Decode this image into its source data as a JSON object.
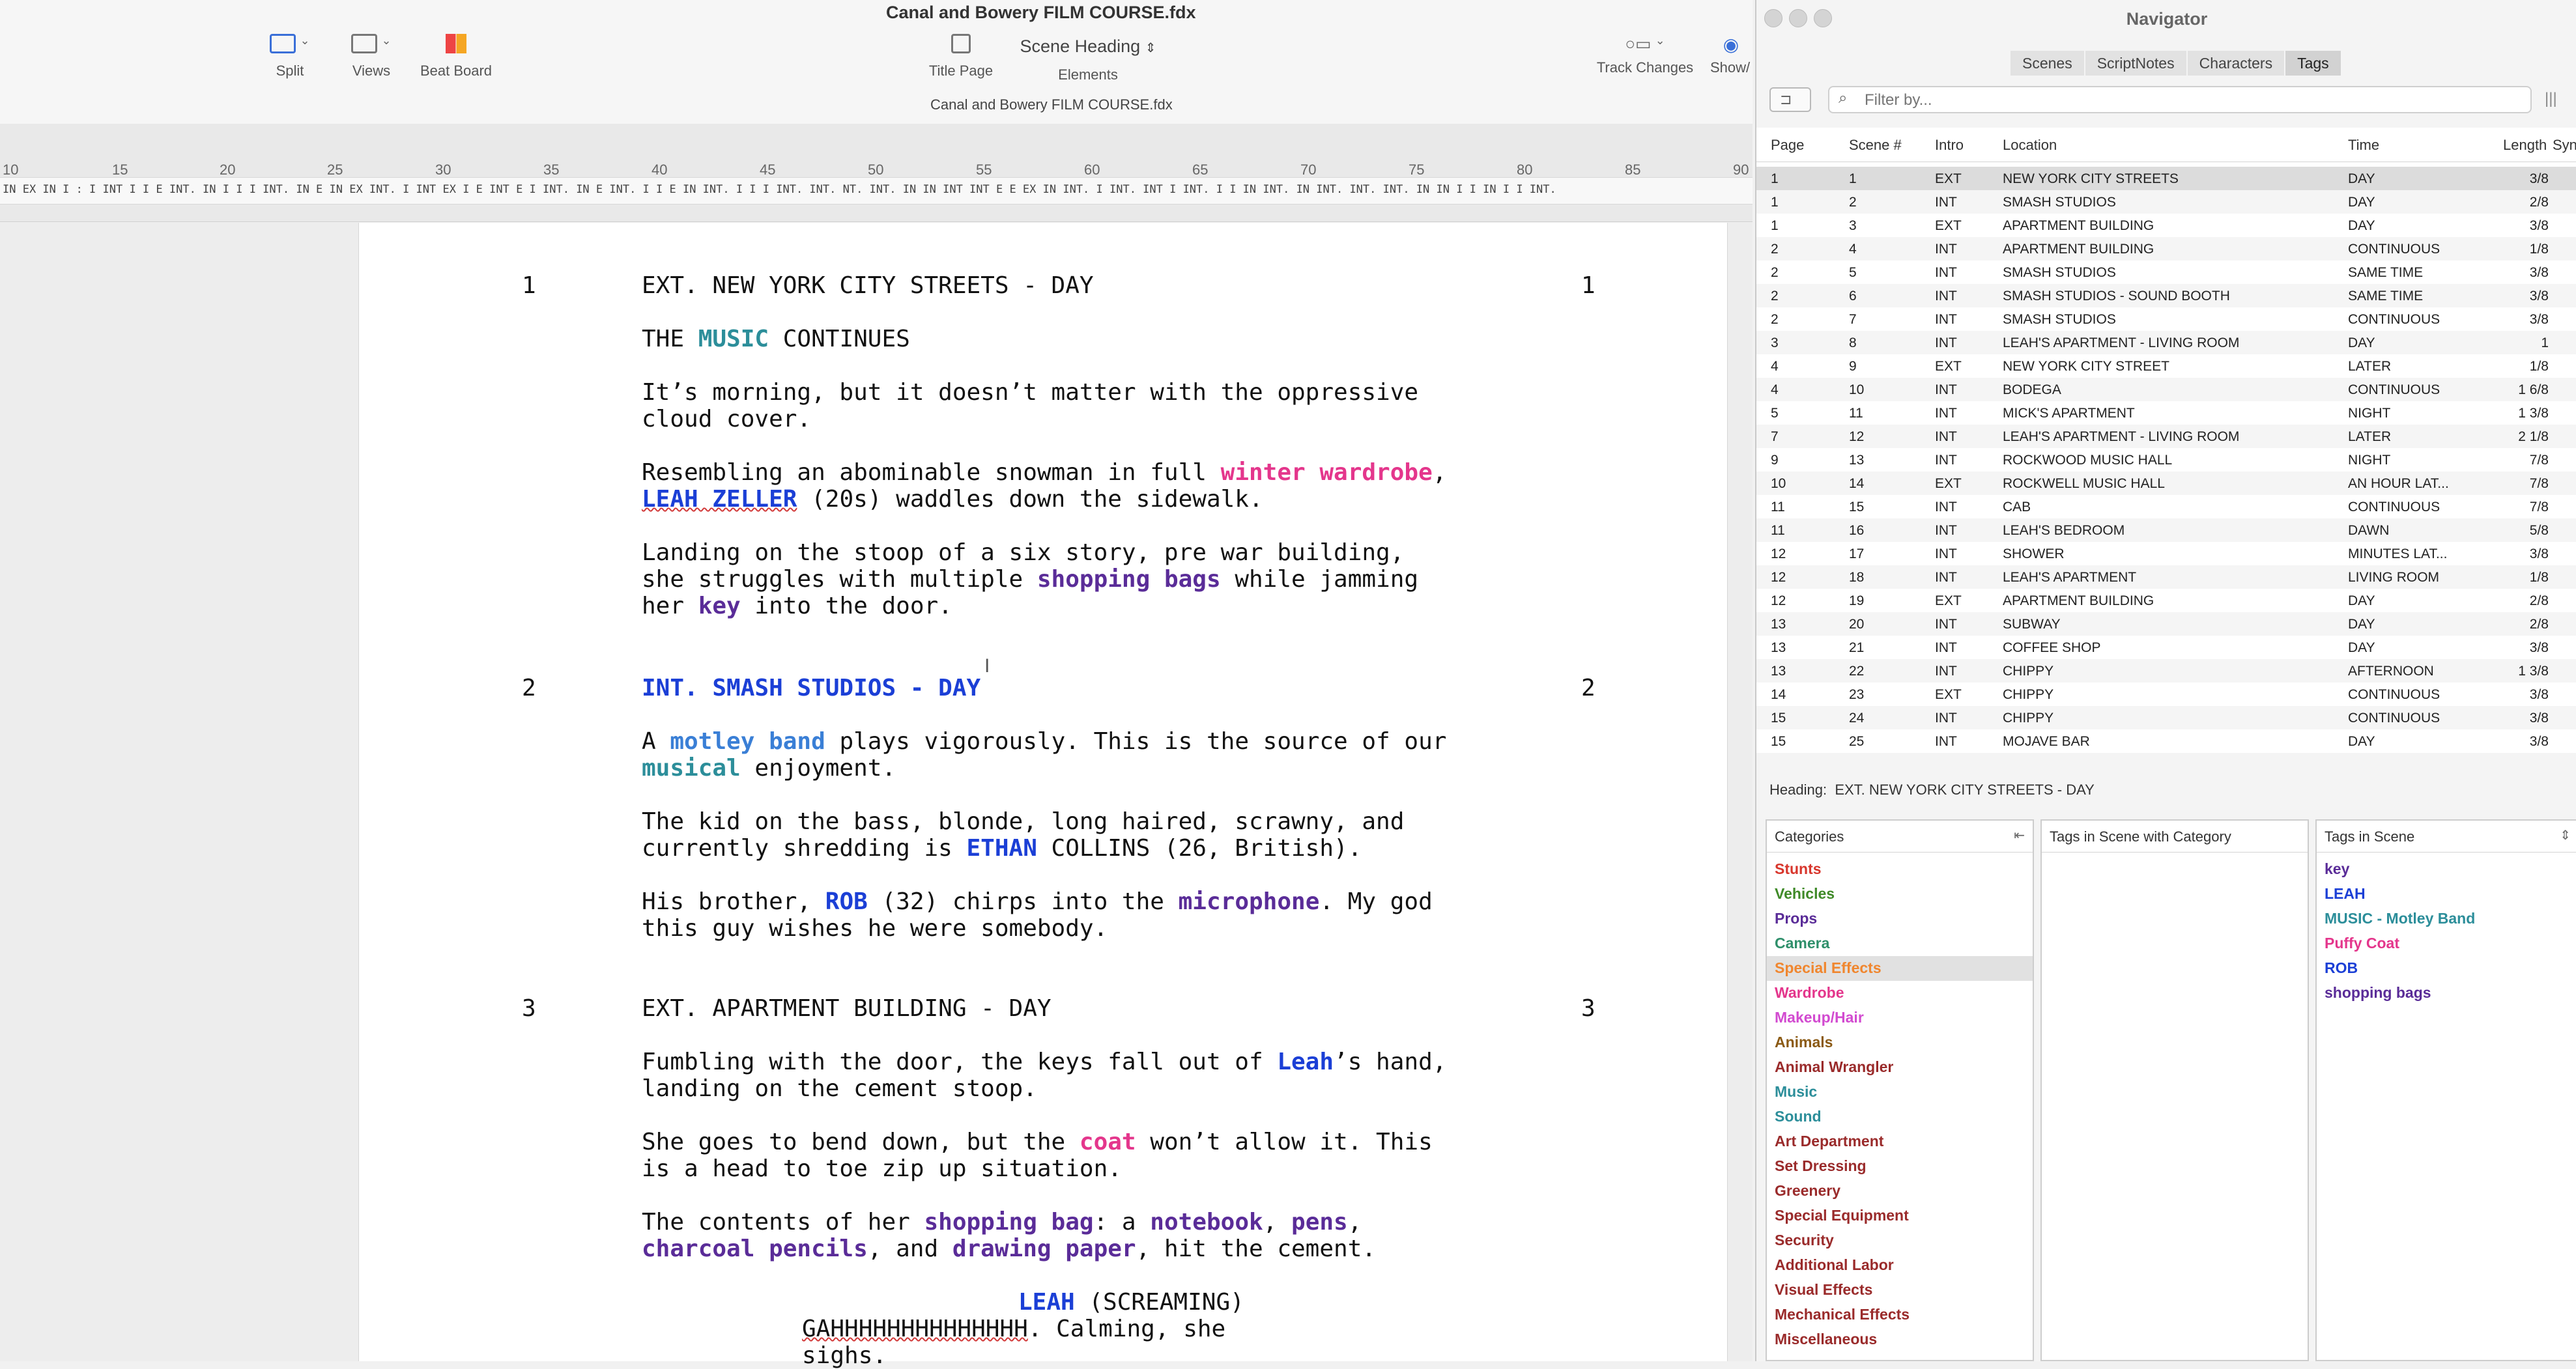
{
  "toolbar": {
    "document_title": "Canal and Bowery FILM COURSE.fdx",
    "document_subtitle": "Canal and Bowery FILM COURSE.fdx",
    "split_label": "Split",
    "views_label": "Views",
    "beat_board_label": "Beat Board",
    "title_page_label": "Title Page",
    "elements_value": "Scene Heading",
    "elements_label": "Elements",
    "track_changes_label": "Track Changes",
    "show_label": "Show/"
  },
  "ruler": {
    "numbers": [
      "10",
      "15",
      "20",
      "25",
      "30",
      "35",
      "40",
      "45",
      "50",
      "55",
      "60",
      "65",
      "70",
      "75",
      "80",
      "85",
      "90"
    ],
    "strip_text": "IN EX IN I : I INT I I E INT. IN I I I INT. IN E IN EX INT. I INT EX I E INT E I  INT.  IN E INT. I I E IN INT. I I I INT. INT. NT. INT. IN IN INT INT E E EX IN INT. I INT. INT I INT. I I IN INT. IN INT.  INT.  INT.  IN IN I I IN I I INT."
  },
  "script": {
    "scenes": [
      {
        "number": "1",
        "heading": "EXT. NEW YORK CITY STREETS - DAY"
      },
      {
        "number": "2",
        "heading": "INT. SMASH STUDIOS - DAY"
      },
      {
        "number": "3",
        "heading": "EXT. APARTMENT BUILDING - DAY"
      }
    ],
    "s1_a1": "THE ",
    "s1_a1_tag": "MUSIC",
    "s1_a1_rest": " CONTINUES",
    "s1_a2_l1": "It’s morning, but it doesn’t matter with the oppressive",
    "s1_a2_l2": "cloud cover.",
    "s1_a3_l1_pre": "Resembling an abominable snowman in full ",
    "s1_a3_l1_tag": "winter wardrobe",
    "s1_a3_l1_post": ",",
    "s1_a3_l2_tag": "LEAH ZELLER",
    "s1_a3_l2_post": " (20s) waddles down the sidewalk.",
    "s1_a4_l1": "Landing on the stoop of a six story, pre war building,",
    "s1_a4_l2_pre": "she struggles with multiple ",
    "s1_a4_l2_tag": "shopping bags",
    "s1_a4_l2_post": " while jamming",
    "s1_a4_l3_pre": "her ",
    "s1_a4_l3_tag": "key",
    "s1_a4_l3_post": " into the door.",
    "s2_a1_l1_pre": "A ",
    "s2_a1_l1_tag": "motley band",
    "s2_a1_l1_post": " plays vigorously. This is the source of our",
    "s2_a1_l2_tag": "musical",
    "s2_a1_l2_post": " enjoyment.",
    "s2_a2_l1": "The kid on the bass, blonde, long haired, scrawny, and",
    "s2_a2_l2_pre": "currently shredding is ",
    "s2_a2_l2_tag": "ETHAN",
    "s2_a2_l2_post": " COLLINS (26, British).",
    "s2_a3_l1_pre": "His brother, ",
    "s2_a3_l1_tag1": "ROB",
    "s2_a3_l1_mid": " (32) chirps into the ",
    "s2_a3_l1_tag2": "microphone",
    "s2_a3_l1_post": ". My god",
    "s2_a3_l2": "this guy wishes he were somebody.",
    "s3_a1_l1_pre": "Fumbling with the door, the keys fall out of ",
    "s3_a1_l1_tag": "Leah",
    "s3_a1_l1_post": "’s hand,",
    "s3_a1_l2": "landing on the cement stoop.",
    "s3_a2_l1_pre": "She goes to bend down, but the ",
    "s3_a2_l1_tag": "coat",
    "s3_a2_l1_post": " won’t allow it. This",
    "s3_a2_l2": "is a head to toe zip up situation.",
    "s3_a3_l1_pre": "The contents of her ",
    "s3_a3_l1_tag1": "shopping bag",
    "s3_a3_l1_mid1": ": a ",
    "s3_a3_l1_tag2": "notebook",
    "s3_a3_l1_mid2": ", ",
    "s3_a3_l1_tag3": "pens",
    "s3_a3_l1_post": ",",
    "s3_a3_l2_tag1": "charcoal pencils",
    "s3_a3_l2_mid": ", and ",
    "s3_a3_l2_tag2": "drawing paper",
    "s3_a3_l2_post": ", hit the cement.",
    "char_name": "LEAH",
    "char_ext": " (SCREAMING)",
    "dlg_l1_wavy": "GAHHHHHHHHHHHHHH",
    "dlg_l1_post": ". Calming, she",
    "dlg_l2": "sighs."
  },
  "navigator": {
    "title": "Navigator",
    "tabs": [
      "Scenes",
      "ScriptNotes",
      "Characters",
      "Tags"
    ],
    "active_tab": "Tags",
    "filter_placeholder": "Filter by...",
    "columns": [
      "Page",
      "Scene #",
      "Intro",
      "Location",
      "Time",
      "Length",
      "Syn"
    ],
    "rows": [
      [
        "1",
        "1",
        "EXT",
        "NEW YORK CITY STREETS",
        "DAY",
        "3/8"
      ],
      [
        "1",
        "2",
        "INT",
        "SMASH STUDIOS",
        "DAY",
        "2/8"
      ],
      [
        "1",
        "3",
        "EXT",
        "APARTMENT BUILDING",
        "DAY",
        "3/8"
      ],
      [
        "2",
        "4",
        "INT",
        "APARTMENT BUILDING",
        "CONTINUOUS",
        "1/8"
      ],
      [
        "2",
        "5",
        "INT",
        "SMASH STUDIOS",
        "SAME TIME",
        "3/8"
      ],
      [
        "2",
        "6",
        "INT",
        "SMASH STUDIOS - SOUND BOOTH",
        "SAME TIME",
        "3/8"
      ],
      [
        "2",
        "7",
        "INT",
        "SMASH STUDIOS",
        "CONTINUOUS",
        "3/8"
      ],
      [
        "3",
        "8",
        "INT",
        "LEAH'S APARTMENT - LIVING ROOM",
        "DAY",
        "1"
      ],
      [
        "4",
        "9",
        "EXT",
        "NEW YORK CITY STREET",
        "LATER",
        "1/8"
      ],
      [
        "4",
        "10",
        "INT",
        "BODEGA",
        "CONTINUOUS",
        "1 6/8"
      ],
      [
        "5",
        "11",
        "INT",
        "MICK'S APARTMENT",
        "NIGHT",
        "1 3/8"
      ],
      [
        "7",
        "12",
        "INT",
        "LEAH'S APARTMENT - LIVING ROOM",
        "LATER",
        "2 1/8"
      ],
      [
        "9",
        "13",
        "INT",
        "ROCKWOOD MUSIC HALL",
        "NIGHT",
        "7/8"
      ],
      [
        "10",
        "14",
        "EXT",
        "ROCKWELL MUSIC HALL",
        "AN HOUR LAT...",
        "7/8"
      ],
      [
        "11",
        "15",
        "INT",
        "CAB",
        "CONTINUOUS",
        "7/8"
      ],
      [
        "11",
        "16",
        "INT",
        "LEAH'S BEDROOM",
        "DAWN",
        "5/8"
      ],
      [
        "12",
        "17",
        "INT",
        "SHOWER",
        "MINUTES LAT...",
        "3/8"
      ],
      [
        "12",
        "18",
        "INT",
        "LEAH'S APARTMENT",
        "LIVING ROOM",
        "1/8"
      ],
      [
        "12",
        "19",
        "EXT",
        "APARTMENT BUILDING",
        "DAY",
        "2/8"
      ],
      [
        "13",
        "20",
        "INT",
        "SUBWAY",
        "DAY",
        "2/8"
      ],
      [
        "13",
        "21",
        "INT",
        "COFFEE SHOP",
        "DAY",
        "3/8"
      ],
      [
        "13",
        "22",
        "INT",
        "CHIPPY",
        "AFTERNOON",
        "1 3/8"
      ],
      [
        "14",
        "23",
        "EXT",
        "CHIPPY",
        "CONTINUOUS",
        "3/8"
      ],
      [
        "15",
        "24",
        "INT",
        "CHIPPY",
        "CONTINUOUS",
        "3/8"
      ],
      [
        "15",
        "25",
        "INT",
        "MOJAVE BAR",
        "DAY",
        "3/8"
      ]
    ],
    "heading_label": "Heading:",
    "heading_value": "EXT. NEW YORK CITY STREETS - DAY",
    "categories_header": "Categories",
    "tags_with_category_header": "Tags in Scene with Category",
    "tags_in_scene_header": "Tags in Scene",
    "categories": [
      {
        "name": "Stunts",
        "color": "#d8362c"
      },
      {
        "name": "Vehicles",
        "color": "#3f8a28"
      },
      {
        "name": "Props",
        "color": "#5a2c98"
      },
      {
        "name": "Camera",
        "color": "#2e8f6a"
      },
      {
        "name": "Special Effects",
        "color": "#f0862e"
      },
      {
        "name": "Wardrobe",
        "color": "#e4368c"
      },
      {
        "name": "Makeup/Hair",
        "color": "#d24ad0"
      },
      {
        "name": "Animals",
        "color": "#8b5a14"
      },
      {
        "name": "Animal Wrangler",
        "color": "#9a2b2b"
      },
      {
        "name": "Music",
        "color": "#2c8e9a"
      },
      {
        "name": "Sound",
        "color": "#2c8e9a"
      },
      {
        "name": "Art Department",
        "color": "#9a2b2b"
      },
      {
        "name": "Set Dressing",
        "color": "#9a2b2b"
      },
      {
        "name": "Greenery",
        "color": "#9a2b2b"
      },
      {
        "name": "Special Equipment",
        "color": "#9a2b2b"
      },
      {
        "name": "Security",
        "color": "#9a2b2b"
      },
      {
        "name": "Additional Labor",
        "color": "#9a2b2b"
      },
      {
        "name": "Visual Effects",
        "color": "#9a2b2b"
      },
      {
        "name": "Mechanical Effects",
        "color": "#9a2b2b"
      },
      {
        "name": "Miscellaneous",
        "color": "#9a2b2b"
      }
    ],
    "selected_category": "Special Effects",
    "scene_tags": [
      {
        "name": "key",
        "color": "#5a2c98"
      },
      {
        "name": "LEAH",
        "color": "#1b3fd6"
      },
      {
        "name": "MUSIC - Motley Band",
        "color": "#2c8e9a"
      },
      {
        "name": "Puffy Coat",
        "color": "#e4368c"
      },
      {
        "name": "ROB",
        "color": "#1b3fd6"
      },
      {
        "name": "shopping bags",
        "color": "#5a2c98"
      }
    ]
  }
}
